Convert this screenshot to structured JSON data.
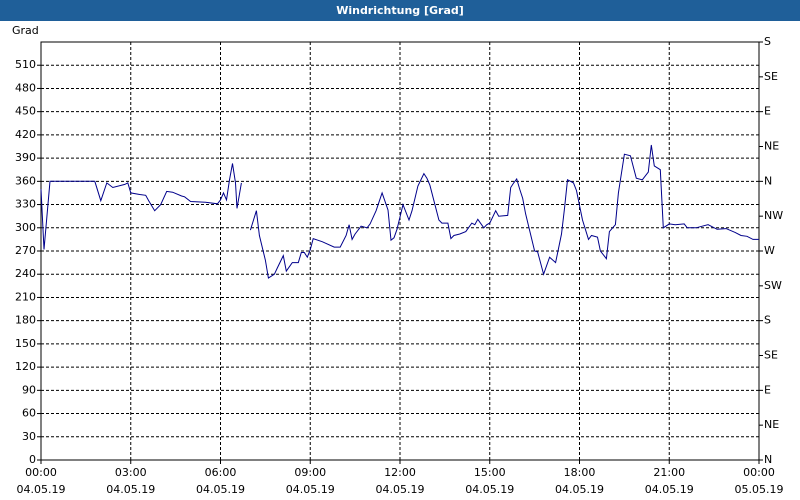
{
  "window": {
    "title": "Windrichtung [Grad]"
  },
  "chart_data": {
    "type": "line",
    "title": "Windrichtung [Grad]",
    "ylabel": "Grad",
    "ylim": [
      0,
      540
    ],
    "yticks": [
      0,
      30,
      60,
      90,
      120,
      150,
      180,
      210,
      240,
      270,
      300,
      330,
      360,
      390,
      420,
      450,
      480,
      510
    ],
    "xlim": [
      "04.05.19 00:00",
      "05.05.19 00:00"
    ],
    "x_unit": "hours",
    "xticks": [
      {
        "time": "00:00",
        "date": "04.05.19",
        "h": 0
      },
      {
        "time": "03:00",
        "date": "04.05.19",
        "h": 3
      },
      {
        "time": "06:00",
        "date": "04.05.19",
        "h": 6
      },
      {
        "time": "09:00",
        "date": "04.05.19",
        "h": 9
      },
      {
        "time": "12:00",
        "date": "04.05.19",
        "h": 12
      },
      {
        "time": "15:00",
        "date": "04.05.19",
        "h": 15
      },
      {
        "time": "18:00",
        "date": "04.05.19",
        "h": 18
      },
      {
        "time": "21:00",
        "date": "04.05.19",
        "h": 21
      },
      {
        "time": "00:00",
        "date": "05.05.19",
        "h": 24
      }
    ],
    "right_axis_labels": [
      {
        "label": "N",
        "value": 0
      },
      {
        "label": "NE",
        "value": 45
      },
      {
        "label": "E",
        "value": 90
      },
      {
        "label": "SE",
        "value": 135
      },
      {
        "label": "S",
        "value": 180
      },
      {
        "label": "SW",
        "value": 225
      },
      {
        "label": "W",
        "value": 270
      },
      {
        "label": "NW",
        "value": 315
      },
      {
        "label": "N",
        "value": 360
      },
      {
        "label": "NE",
        "value": 405
      },
      {
        "label": "E",
        "value": 450
      },
      {
        "label": "SE",
        "value": 495
      },
      {
        "label": "S",
        "value": 540
      }
    ],
    "grid": true,
    "colors": {
      "line": "#00008b",
      "grid": "#000000",
      "titlebar": "#1f5f99"
    },
    "series": [
      {
        "segments": [
          [
            [
              0,
              350
            ],
            [
              0.1,
              272
            ],
            [
              0.3,
              360
            ],
            [
              1.0,
              360
            ],
            [
              1.8,
              360
            ],
            [
              2.0,
              335
            ],
            [
              2.2,
              358
            ],
            [
              2.4,
              352
            ],
            [
              2.8,
              356
            ],
            [
              2.9,
              358
            ],
            [
              3.0,
              345
            ],
            [
              3.3,
              343
            ],
            [
              3.5,
              342
            ],
            [
              3.6,
              335
            ],
            [
              3.8,
              322
            ],
            [
              4.0,
              330
            ],
            [
              4.2,
              347
            ],
            [
              4.4,
              346
            ],
            [
              4.7,
              341
            ],
            [
              4.8,
              340
            ],
            [
              5.0,
              334
            ],
            [
              5.5,
              333
            ],
            [
              5.9,
              331
            ],
            [
              6.0,
              336
            ],
            [
              6.1,
              345
            ],
            [
              6.2,
              336
            ],
            [
              6.3,
              362
            ],
            [
              6.4,
              383
            ],
            [
              6.5,
              358
            ],
            [
              6.55,
              325
            ],
            [
              6.7,
              358
            ]
          ],
          [
            [
              7.0,
              297
            ],
            [
              7.2,
              322
            ],
            [
              7.3,
              290
            ],
            [
              7.5,
              258
            ],
            [
              7.6,
              235
            ],
            [
              7.8,
              240
            ],
            [
              7.9,
              248
            ],
            [
              8.1,
              264
            ],
            [
              8.2,
              244
            ],
            [
              8.4,
              255
            ],
            [
              8.6,
              255
            ],
            [
              8.7,
              268
            ],
            [
              8.8,
              268
            ],
            [
              8.9,
              262
            ],
            [
              9.0,
              272
            ],
            [
              9.1,
              286
            ],
            [
              9.4,
              282
            ],
            [
              9.8,
              275
            ],
            [
              10.0,
              275
            ],
            [
              10.2,
              290
            ],
            [
              10.3,
              304
            ],
            [
              10.4,
              285
            ],
            [
              10.5,
              292
            ],
            [
              10.7,
              302
            ],
            [
              10.9,
              300
            ],
            [
              11.0,
              305
            ],
            [
              11.2,
              322
            ],
            [
              11.4,
              345
            ],
            [
              11.6,
              323
            ],
            [
              11.7,
              284
            ],
            [
              11.8,
              287
            ],
            [
              11.9,
              298
            ],
            [
              12.1,
              330
            ],
            [
              12.3,
              310
            ],
            [
              12.4,
              322
            ],
            [
              12.6,
              354
            ],
            [
              12.8,
              370
            ],
            [
              12.9,
              364
            ],
            [
              13.0,
              355
            ],
            [
              13.3,
              310
            ],
            [
              13.4,
              306
            ],
            [
              13.6,
              306
            ],
            [
              13.7,
              286
            ],
            [
              13.8,
              290
            ],
            [
              14.0,
              292
            ],
            [
              14.2,
              295
            ],
            [
              14.4,
              306
            ],
            [
              14.5,
              304
            ],
            [
              14.6,
              311
            ],
            [
              14.8,
              300
            ],
            [
              14.9,
              304
            ],
            [
              15.0,
              306
            ],
            [
              15.2,
              322
            ],
            [
              15.3,
              315
            ],
            [
              15.6,
              316
            ],
            [
              15.7,
              352
            ],
            [
              15.8,
              358
            ],
            [
              15.9,
              363
            ],
            [
              16.0,
              350
            ],
            [
              16.1,
              338
            ],
            [
              16.2,
              318
            ],
            [
              16.5,
              270
            ],
            [
              16.6,
              269
            ],
            [
              16.8,
              240
            ],
            [
              17.0,
              262
            ],
            [
              17.2,
              255
            ],
            [
              17.4,
              292
            ],
            [
              17.5,
              325
            ],
            [
              17.6,
              362
            ],
            [
              17.8,
              358
            ],
            [
              17.9,
              348
            ],
            [
              18.1,
              310
            ],
            [
              18.3,
              285
            ],
            [
              18.4,
              290
            ],
            [
              18.6,
              288
            ],
            [
              18.7,
              270
            ],
            [
              18.9,
              260
            ],
            [
              19.0,
              295
            ],
            [
              19.2,
              304
            ],
            [
              19.3,
              345
            ],
            [
              19.5,
              395
            ],
            [
              19.7,
              393
            ],
            [
              19.9,
              364
            ],
            [
              20.1,
              362
            ],
            [
              20.3,
              372
            ],
            [
              20.4,
              407
            ],
            [
              20.5,
              380
            ],
            [
              20.7,
              375
            ],
            [
              20.8,
              300
            ],
            [
              21.0,
              305
            ],
            [
              21.2,
              304
            ],
            [
              21.5,
              305
            ],
            [
              21.6,
              300
            ],
            [
              21.9,
              300
            ],
            [
              22.1,
              302
            ],
            [
              22.3,
              304
            ],
            [
              22.4,
              302
            ],
            [
              22.6,
              298
            ],
            [
              22.9,
              299
            ],
            [
              23.2,
              294
            ],
            [
              23.4,
              290
            ],
            [
              23.6,
              289
            ],
            [
              23.8,
              285
            ],
            [
              24.0,
              285
            ]
          ]
        ]
      }
    ]
  }
}
